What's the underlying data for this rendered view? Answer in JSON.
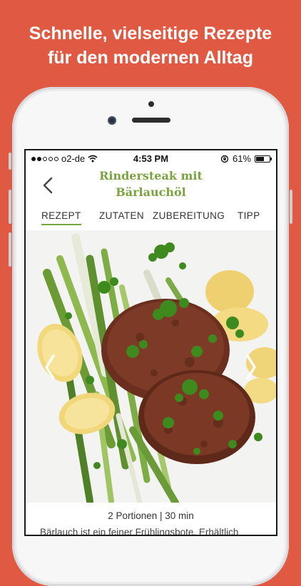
{
  "promo": {
    "line1": "Schnelle, vielseitige Rezepte",
    "line2": "für den modernen Alltag",
    "background_color": "#e05a43"
  },
  "status_bar": {
    "carrier": "o2-de",
    "time": "4:53 PM",
    "battery_percent": "61%",
    "battery_level": 0.61,
    "signal_bars_filled": 2,
    "signal_bars_total": 5
  },
  "header": {
    "title_line1": "Rindersteak mit",
    "title_line2": "Bärlauchöl",
    "accent_color": "#7aa33f"
  },
  "tabs": [
    {
      "label": "REZEPT",
      "active": true
    },
    {
      "label": "ZUTATEN",
      "active": false
    },
    {
      "label": "ZUBEREITUNG",
      "active": false
    },
    {
      "label": "TIPP",
      "active": false
    }
  ],
  "recipe": {
    "meta": "2 Portionen | 30 min",
    "intro": "Bärlauch ist ein feiner Frühlingsbote. Erhältlich"
  },
  "icons": {
    "back": "chevron-left-icon",
    "prev_image": "chevron-left-icon",
    "next_image": "chevron-right-icon"
  }
}
